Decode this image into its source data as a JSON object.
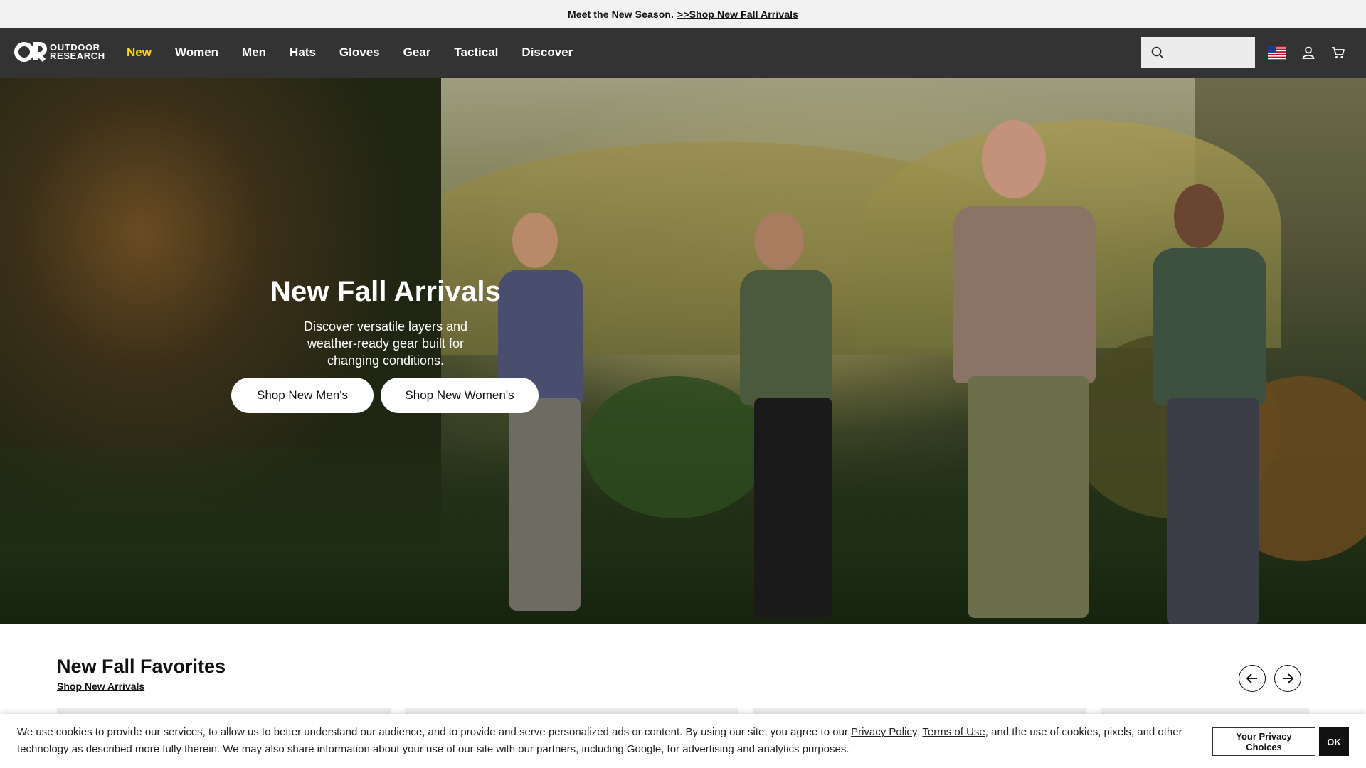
{
  "promo": {
    "text": "Meet the New Season.",
    "link": ">>Shop New Fall Arrivals"
  },
  "header": {
    "logo_line1": "OUTDOOR",
    "logo_line2": "RESEARCH",
    "nav": [
      "New",
      "Women",
      "Men",
      "Hats",
      "Gloves",
      "Gear",
      "Tactical",
      "Discover"
    ],
    "search_placeholder": ""
  },
  "hero": {
    "title": "New Fall Arrivals",
    "subtitle": "Discover versatile layers and weather-ready gear built for changing conditions.",
    "cta_men": "Shop New Men's",
    "cta_women": "Shop New Women's"
  },
  "favorites": {
    "title": "New Fall Favorites",
    "link": "Shop New Arrivals"
  },
  "cookie": {
    "text_before": "We use cookies to provide our services, to allow us to better understand our audience, and to provide and serve personalized ads or content. By using our site, you agree to our ",
    "privacy_link": "Privacy Policy",
    "comma": ", ",
    "terms_link": "Terms of Use",
    "text_after": ", and the use of cookies, pixels, and other technology as described more fully therein. We may also share information about your use of our site with our partners, including Google, for advertising and analytics purposes.",
    "privacy_choices": "Your Privacy Choices",
    "ok": "OK"
  },
  "colors": {
    "header_bg": "#333333",
    "active_nav": "#ffd21f",
    "promo_bg": "#f2f2f2"
  },
  "icons": [
    "search-icon",
    "us-flag-icon",
    "account-icon",
    "cart-icon",
    "arrow-left-icon",
    "arrow-right-icon"
  ]
}
